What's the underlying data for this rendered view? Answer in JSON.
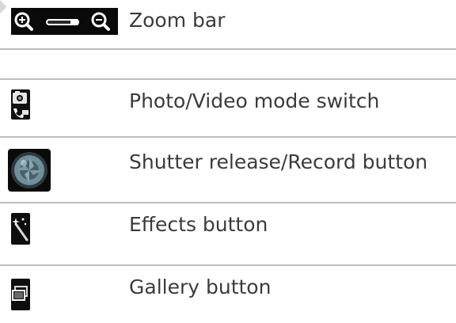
{
  "legend": {
    "items": [
      {
        "label": "Zoom bar",
        "icon": "zoom-bar-icon"
      },
      {
        "label": "",
        "icon": ""
      },
      {
        "label": "Photo/Video mode switch",
        "icon": "photo-video-switch-icon"
      },
      {
        "label": "Shutter release/Record button",
        "icon": "shutter-icon"
      },
      {
        "label": "Effects button",
        "icon": "effects-wand-icon"
      },
      {
        "label": "Gallery button",
        "icon": "gallery-icon"
      }
    ]
  }
}
